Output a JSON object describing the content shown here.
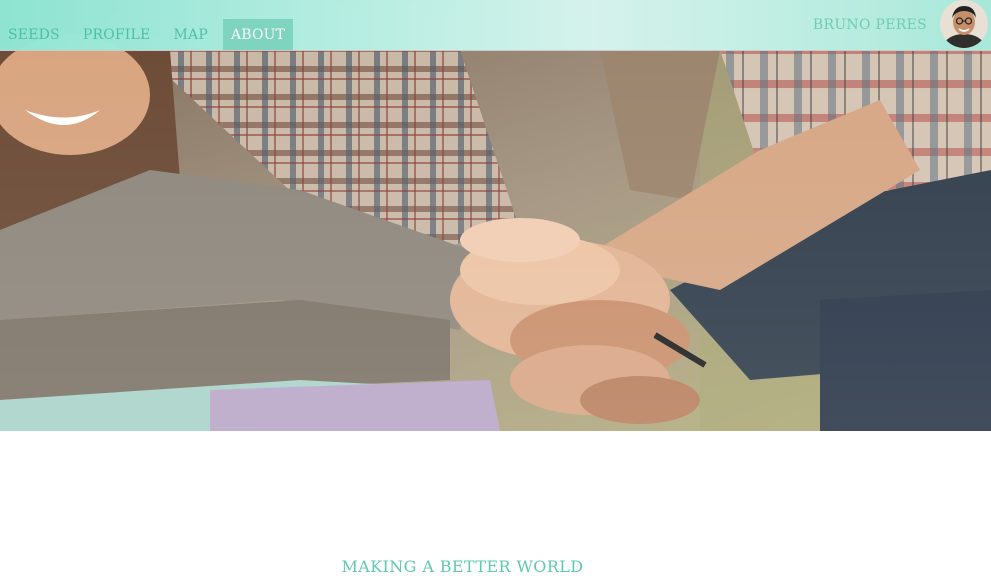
{
  "nav": {
    "items": [
      {
        "label": "SEEDS",
        "active": false
      },
      {
        "label": "PROFILE",
        "active": false
      },
      {
        "label": "MAP",
        "active": false
      },
      {
        "label": "ABOUT",
        "active": true
      }
    ],
    "accent_color": "#5dc9b0",
    "active_bg": "#7fd8c4"
  },
  "user": {
    "name": "BRUNO PERES",
    "avatar_icon": "user-avatar-photo"
  },
  "hero": {
    "image": "hands-stacked-teamwork-photo"
  },
  "main": {
    "headline": "MAKING A BETTER WORLD"
  }
}
